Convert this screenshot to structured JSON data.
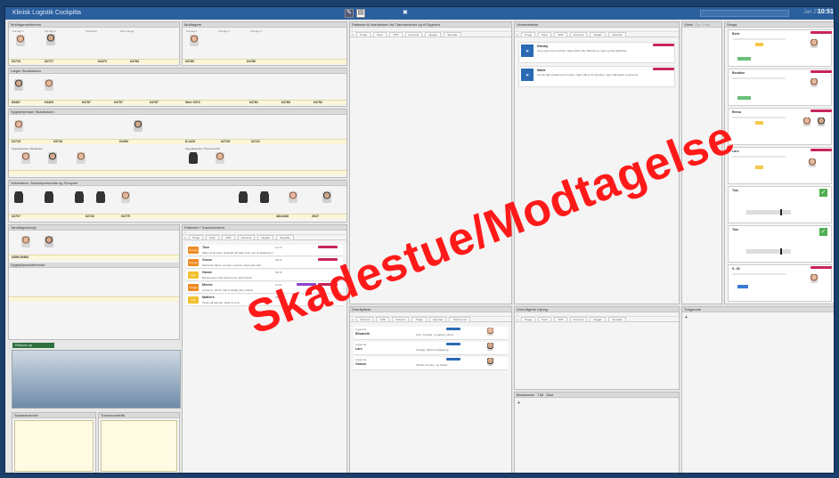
{
  "app": {
    "title": "Klinisk Logistik Cockpitta",
    "date": "Jan 27",
    "time": "10:51",
    "watermark": "Skadestue/Modtagelse"
  },
  "left_panels": {
    "modtager1": {
      "title": "Modtagersektionen",
      "slots": [
        "Forvagt 1",
        "Forvagt 2",
        "Telefonist",
        "Sect Laege"
      ],
      "codes": [
        "62710",
        "62717",
        "64473",
        "64784"
      ]
    },
    "modtager2": {
      "title": "Modtagere",
      "slots": [
        "Forvagt 1",
        "Forvagt 2",
        "Forvagt 3"
      ],
      "codes": [
        "64780",
        "64786"
      ]
    },
    "laeger": {
      "title": "Læger Skadestuen",
      "codes": [
        "84467",
        "64429",
        "64787",
        "64797",
        "64787",
        "Skd: 6372",
        "64781",
        "64783",
        "64752"
      ]
    },
    "sygeplejersker": {
      "title": "Sygeplejersker Skadestuen",
      "codes": [
        "62719",
        "63718",
        "62454",
        "8:1420",
        "62725",
        "62721"
      ],
      "sub1": "Sygeplejersker Skadestue",
      "sub2": "Sygeplejersker Traumecenter"
    },
    "sekretaer": {
      "title": "Sekretærer, Servicepersonale og Forsyner",
      "codes": [
        "62707",
        "62722",
        "64779",
        "4814428",
        "2027"
      ]
    },
    "samlet": {
      "title": "Tandlægekirurgi",
      "code": "6459:29466",
      "sub": "Sygeplejestudierende"
    },
    "green_label": "Rescue op",
    "notes1": "Skadestuenote",
    "notes2": "Traumeoverblik"
  },
  "middle_list1": {
    "title": "Patienter i Traumecentret",
    "columns": [
      "Triage",
      "Navn",
      "CPR",
      "Ankomst",
      "Opgjørt",
      "Speciale"
    ],
    "rows": [
      {
        "tag": "Orange",
        "name": "Tove",
        "text": "Slået ud af cykel, skrabsår på højre knæ, ses af skadestuen",
        "time": "10:15",
        "color": "#ef8a21"
      },
      {
        "tag": "Orange",
        "name": "Gusse",
        "text": "Mistænkt fraktur, smerter i venstre ankel efter fald",
        "time": "09:55",
        "color": "#ef8a21"
      },
      {
        "tag": "Gul",
        "name": "Hanne",
        "text": "Brystsmerter, fast hjerterytme, EKG bestilt",
        "time": "09:45",
        "color": "#f2c12e"
      },
      {
        "tag": "Orange",
        "name": "Merete",
        "text": "Cyclemix, 20:21, haft til stadig rødt, kvalme",
        "time": "11:01",
        "color": "#ef8a21"
      },
      {
        "tag": "Gul",
        "name": "Mathers",
        "text": "Tanke på hænder, skær fra 2 år",
        "time": "08:58",
        "color": "#f2c12e"
      }
    ]
  },
  "middle_list2": {
    "title": "Patienter til skadestuen fra Traumecenter og til Sygehus",
    "columns": [
      "Triage",
      "Navn",
      "CPR",
      "Ankomst",
      "Opgjørt",
      "Speciale"
    ]
  },
  "bottom_mid": {
    "title": "Overflyttede",
    "columns": [
      "Ankomst",
      "CPR",
      "Ankomst",
      "Triage",
      "Speciale",
      "Tidsrummet"
    ],
    "rows": [
      {
        "label": "Liggende",
        "name": "Elisabeth",
        "text": "Kom i kontakt, ny patient, tilbud"
      },
      {
        "label": "Liggende",
        "name": "Lars",
        "text": "Udsolgt, 2024 til opfølgning"
      },
      {
        "label": "Liggende",
        "name": "Gaussi",
        "text": "Tilbudt, til intern, og fundet"
      }
    ]
  },
  "vent_panel": {
    "title": "Venteværelse",
    "columns": [
      "Triage",
      "Navn",
      "CPR",
      "Ankomst",
      "Opgjørt",
      "Speciale"
    ],
    "notes": [
      {
        "name": "Nikolaj",
        "text": "Ung mand med smerter i højre hånd efter fald på vej, ingen synlig fejlstilling."
      },
      {
        "name": "Maria",
        "text": "Kvinde fået stukket af en hveps i højre hånd, let hævelse, ingen allergiske symptomer."
      }
    ]
  },
  "triage_panel": {
    "title": "Overvågede Lejring",
    "columns": [
      "Triage",
      "Navn",
      "CPR",
      "Ankomst",
      "Opgjørt",
      "Speciale"
    ]
  },
  "medsender_panel": {
    "title": "Medsender",
    "tabs": [
      "TIM",
      "Ekst"
    ]
  },
  "video_panel": {
    "title": "Video",
    "tab2": "Opr. Proc"
  },
  "staff_panel": {
    "title": "Sengs",
    "cards": [
      {
        "name": "Bent"
      },
      {
        "name": "Bendtse"
      },
      {
        "name": "Bresa"
      },
      {
        "name": "Lars"
      },
      {
        "name": "Tom"
      },
      {
        "name": "Tom"
      },
      {
        "name": "K. 36"
      }
    ]
  },
  "trigger_panel": {
    "title": "Triagenote"
  }
}
